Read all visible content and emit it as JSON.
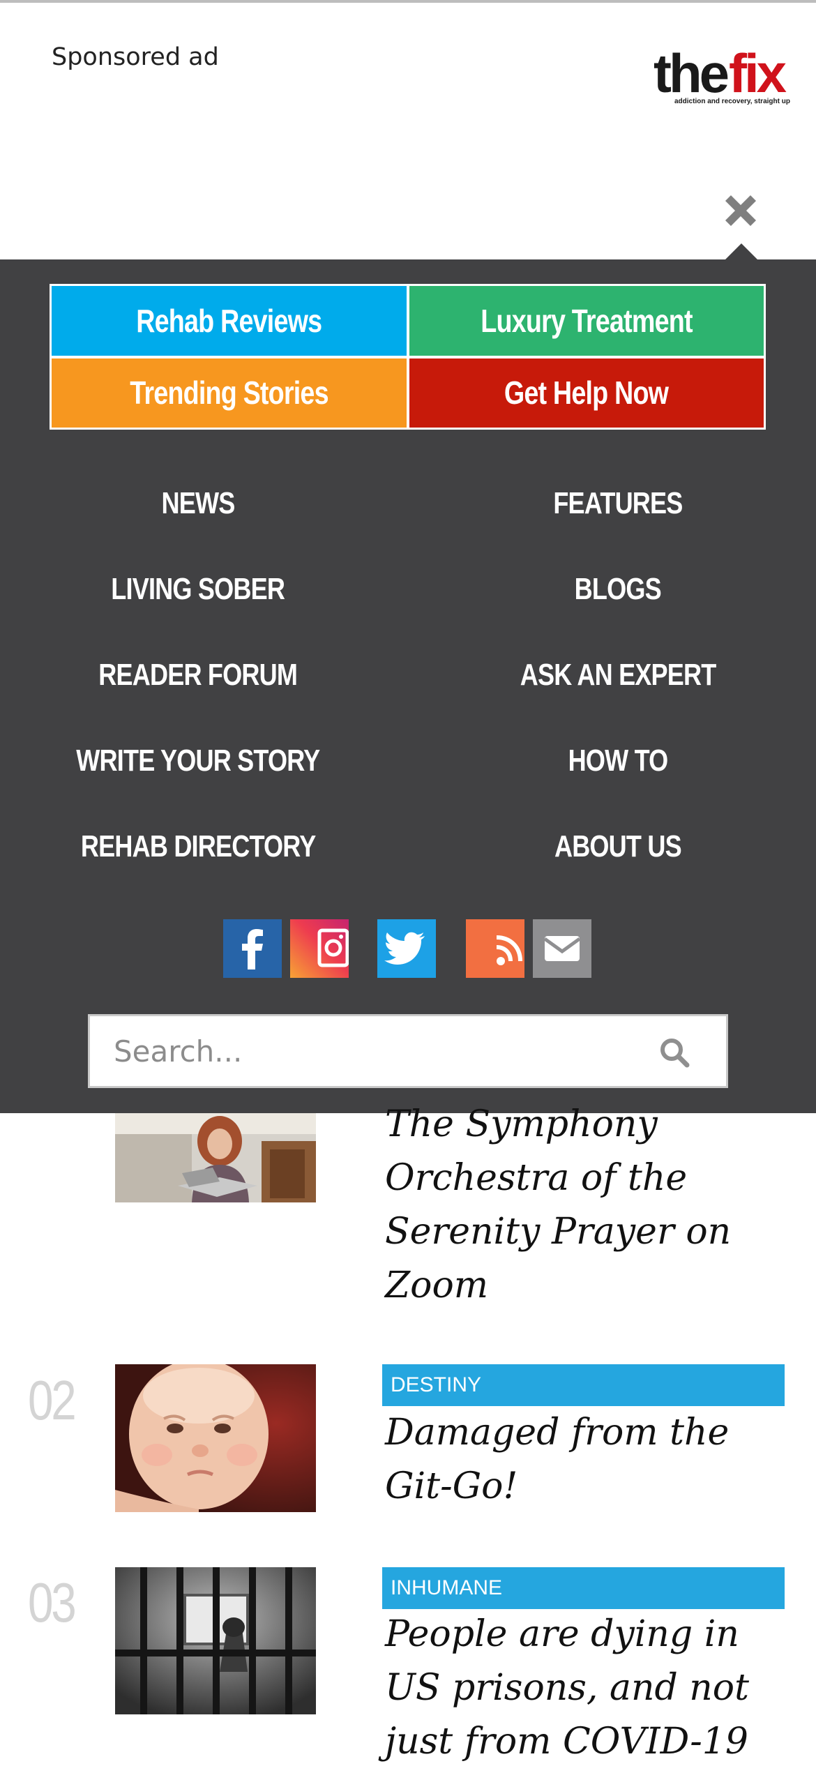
{
  "header": {
    "sponsored_label": "Sponsored ad",
    "logo": {
      "word1": "the",
      "word2": "fix",
      "tagline": "addiction and recovery, straight up"
    },
    "close_icon": "close-icon"
  },
  "menu": {
    "quick_links": [
      {
        "label": "Rehab Reviews",
        "color": "#00abeb"
      },
      {
        "label": "Luxury Treatment",
        "color": "#2db36f"
      },
      {
        "label": "Trending Stories",
        "color": "#f7971f"
      },
      {
        "label": "Get Help Now",
        "color": "#c71a0a"
      }
    ],
    "nav": [
      {
        "label": "NEWS"
      },
      {
        "label": "FEATURES"
      },
      {
        "label": "LIVING SOBER"
      },
      {
        "label": "BLOGS"
      },
      {
        "label": "READER FORUM"
      },
      {
        "label": "ASK AN EXPERT"
      },
      {
        "label": "WRITE YOUR STORY"
      },
      {
        "label": "HOW TO"
      },
      {
        "label": "REHAB DIRECTORY"
      },
      {
        "label": "ABOUT US"
      }
    ],
    "social": [
      {
        "name": "facebook-icon",
        "color": "#2764a8"
      },
      {
        "name": "instagram-icon",
        "color": "#ee3c4f"
      },
      {
        "name": "twitter-icon",
        "color": "#1da1e6"
      },
      {
        "name": "rss-icon",
        "color": "#f26f41"
      },
      {
        "name": "email-icon",
        "color": "#8f8f91"
      }
    ],
    "search": {
      "placeholder": "Search...",
      "value": "",
      "icon": "search-icon"
    }
  },
  "articles": [
    {
      "number": "",
      "category": "",
      "title": "The Symphony Orchestra of the Serenity Prayer on Zoom"
    },
    {
      "number": "02",
      "category": "DESTINY",
      "title": "Damaged from the Git-Go!"
    },
    {
      "number": "03",
      "category": "INHUMANE",
      "title": "People are dying in US prisons, and not just from COVID-19"
    }
  ]
}
